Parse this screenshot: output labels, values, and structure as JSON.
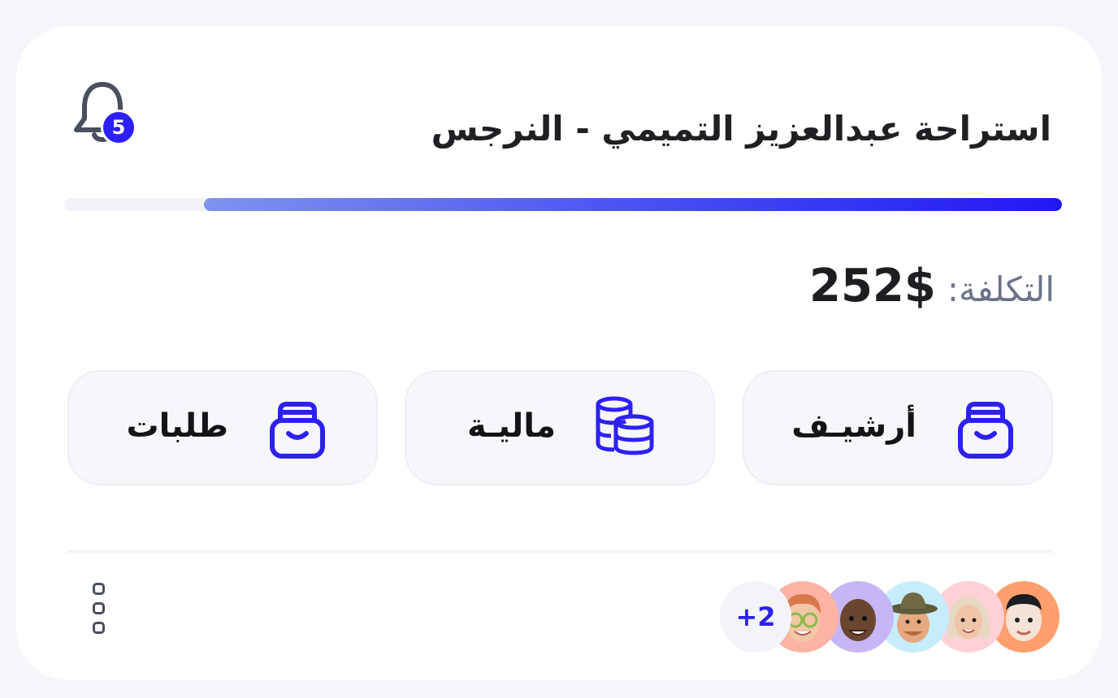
{
  "card": {
    "title": "استراحة عبدالعزيز التميمي - النرجس",
    "notifications": {
      "icon": "bell-icon",
      "count": "5"
    },
    "progress": {
      "value_percent": 86
    },
    "cost": {
      "label": "التكلفة:",
      "value": "252$"
    }
  },
  "actions": [
    {
      "label": "أرشيـف",
      "icon": "archive-box-icon"
    },
    {
      "label": "ماليـة",
      "icon": "coins-stack-icon"
    },
    {
      "label": "طلبات",
      "icon": "archive-box-icon"
    }
  ],
  "members": {
    "extra_count": "+2",
    "avatars": [
      {
        "icon": "memoji-avatar-orange",
        "bg": "#ff9f6e"
      },
      {
        "icon": "memoji-avatar-pink",
        "bg": "#ffd0d6"
      },
      {
        "icon": "memoji-avatar-cyan",
        "bg": "#c7ecfb"
      },
      {
        "icon": "memoji-avatar-purple",
        "bg": "#c7b6f6"
      },
      {
        "icon": "memoji-avatar-salmon",
        "bg": "#ffb3a4"
      }
    ]
  },
  "more_menu": {
    "icon": "vertical-dots-icon"
  },
  "colors": {
    "accent": "#2d20f5",
    "text": "#1f1f24",
    "muted": "#6c7389",
    "tile_bg": "#f6f7fc"
  }
}
